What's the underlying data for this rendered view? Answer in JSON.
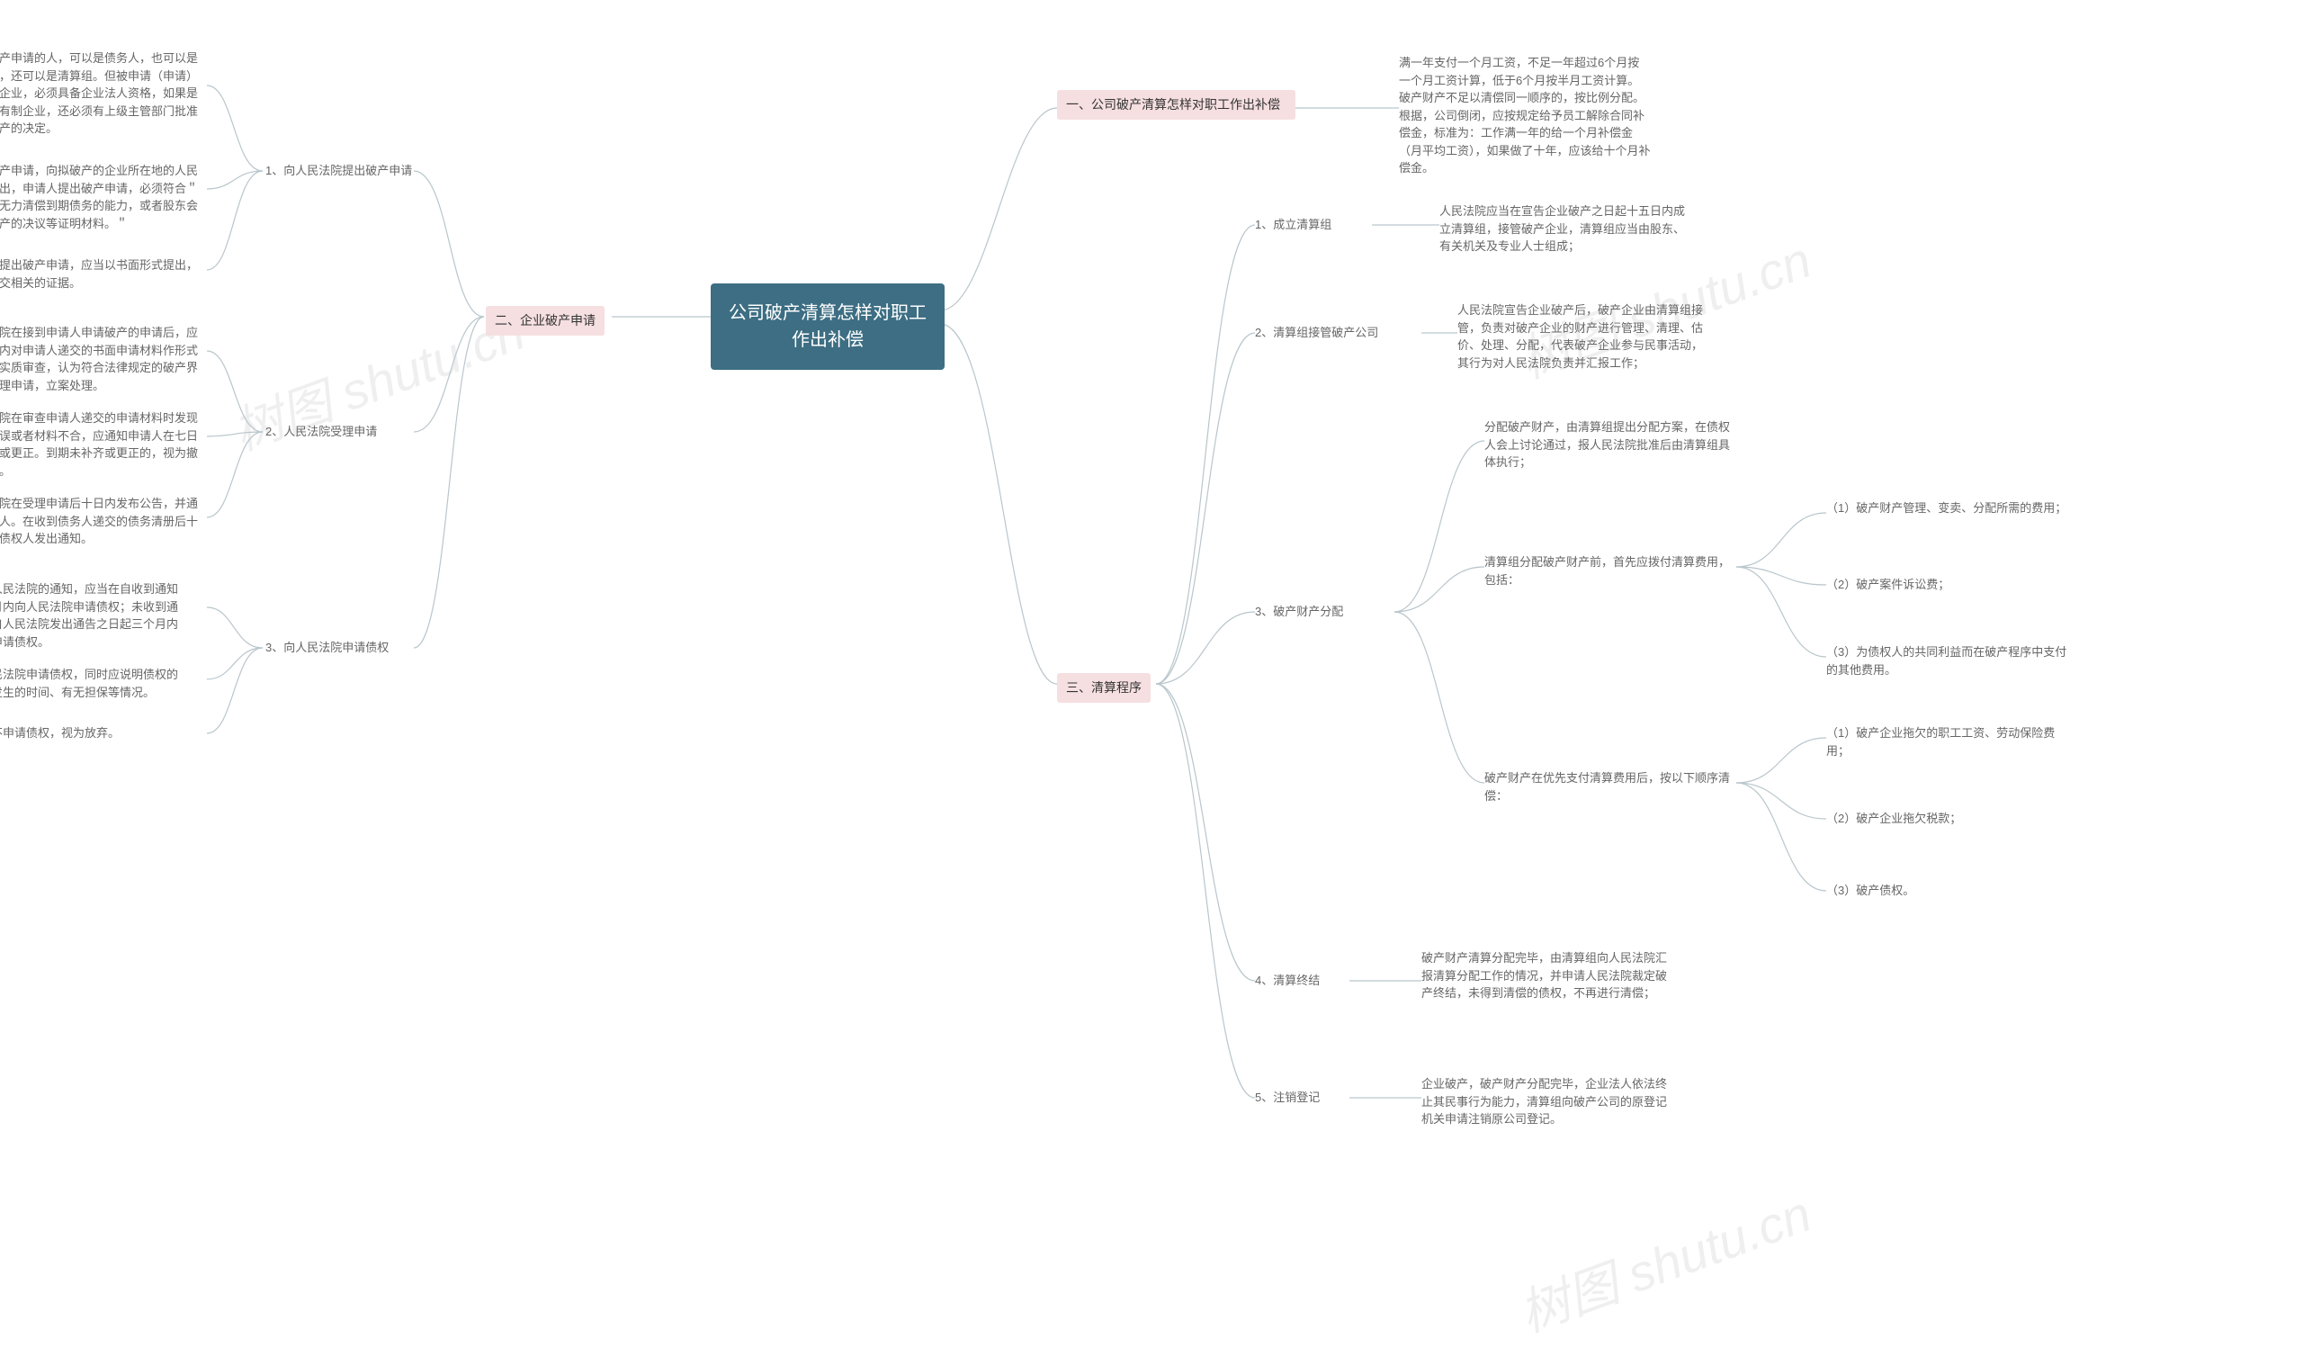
{
  "root": "公司破产清算怎样对职工作出补偿",
  "watermarks": [
    "树图 shutu.cn",
    "树图 shutu.cn",
    "树图 shutu.cn"
  ],
  "right": {
    "s1": {
      "label": "一、公司破产清算怎样对职工作出补偿",
      "leaf": "满一年支付一个月工资，不足一年超过6个月按一个月工资计算，低于6个月按半月工资计算。破产财产不足以清偿同一顺序的，按比例分配。根据，公司倒闭，应按规定给予员工解除合同补偿金，标准为：工作满一年的给一个月补偿金（月平均工资），如果做了十年，应该给十个月补偿金。"
    },
    "s3": {
      "label": "三、清算程序",
      "n1": {
        "label": "1、成立清算组",
        "leaf": "人民法院应当在宣告企业破产之日起十五日内成立清算组，接管破产企业，清算组应当由股东、有关机关及专业人士组成；"
      },
      "n2": {
        "label": "2、清算组接管破产公司",
        "leaf": "人民法院宣告企业破产后，破产企业由清算组接管，负责对破产企业的财产进行管理、清理、估价、处理、分配，代表破产企业参与民事活动，其行为对人民法院负责并汇报工作；"
      },
      "n3": {
        "label": "3、破产财产分配",
        "c1": "分配破产财产，由清算组提出分配方案，在债权人会上讨论通过，报人民法院批准后由清算组具体执行；",
        "c2": {
          "label": "清算组分配破产财产前，首先应拨付清算费用，包括：",
          "i1": "（1）破产财产管理、变卖、分配所需的费用；",
          "i2": "（2）破产案件诉讼费；",
          "i3": "（3）为债权人的共同利益而在破产程序中支付的其他费用。"
        },
        "c3": {
          "label": "破产财产在优先支付清算费用后，按以下顺序清偿：",
          "i1": "（1）破产企业拖欠的职工工资、劳动保险费用；",
          "i2": "（2）破产企业拖欠税款；",
          "i3": "（3）破产债权。"
        }
      },
      "n4": {
        "label": "4、清算终结",
        "leaf": "破产财产清算分配完毕，由清算组向人民法院汇报清算分配工作的情况，并申请人民法院裁定破产终结，未得到清偿的债权，不再进行清偿；"
      },
      "n5": {
        "label": "5、注销登记",
        "leaf": "企业破产，破产财产分配完毕，企业法人依法终止其民事行为能力，清算组向破产公司的原登记机关申请注销原公司登记。"
      }
    }
  },
  "left": {
    "s2": {
      "label": "二、企业破产申请",
      "n1": {
        "label": "1、向人民法院提出破产申请",
        "c1": "提出破产申请的人，可以是债务人，也可以是债权人，还可以是清算组。但被申请（申请）破产的企业，必须具备企业法人资格，如果是全民所有制企业，还必须有上级主管部门批准同意破产的决定。",
        "c2": "提出破产申请，向拟破产的企业所在地的人民法院提出，申请人提出破产申请，必须符合＂企业已无力清偿到期债务的能力，或者股东会同意破产的决议等证明材料。＂",
        "c3": "申请人提出破产申请，应当以书面形式提出，同时提交相关的证据。"
      },
      "n2": {
        "label": "2、人民法院受理申请",
        "c1": "人民法院在接到申请人申请破产的申请后，应在七日内对申请人递交的书面申请材料作形式审查和实质审查，认为符合法律规定的破产界定，受理申请，立案处理。",
        "c2": "人民法院在审查申请人递交的申请材料时发现材料有误或者材料不合，应通知申请人在七日内补齐或更正。到期未补齐或更正的，视为撤回申请。",
        "c3": "人民法院在受理申请后十日内发布公告，并通知债务人。在收到债务人递交的债务清册后十日内向债权人发出通知。"
      },
      "n3": {
        "label": "3、向人民法院申请债权",
        "c1": "债权人接到人民法院的通知，应当在自收到通知之日起一个月内向人民法院申请债权；未收到通知的债权人自人民法院发出通告之日起三个月内向人民法院申请债权。",
        "c2": "债权人向人民法院申请债权，同时应说明债权的性质、债权发生的时间、有无担保等情况。",
        "c3": "债权人到期不申请债权，视为放弃。"
      }
    }
  }
}
